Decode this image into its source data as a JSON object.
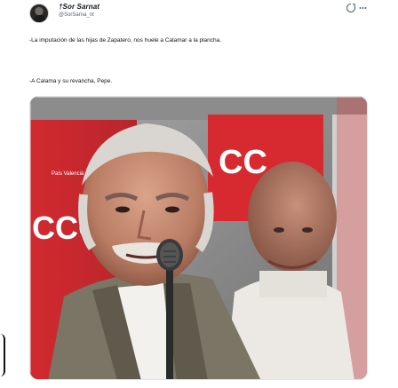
{
  "author": {
    "display_name": "†Sor Sarnat",
    "handle": "@SorSarna_nt"
  },
  "tweet": {
    "paragraph_1": "-La imputación de las hijas de Zapatero, nos huele a Calamar a la plancha.",
    "paragraph_2": "-A Calama y su revancha, Pepe."
  },
  "media": {
    "sign_text_left": "CCOO",
    "sign_text_right": "CC",
    "sign_small_text": "País Valencià",
    "brand_red": "#d8272d"
  },
  "icons": {
    "avatar": "avatar-image",
    "more": "grok-more-icon"
  }
}
